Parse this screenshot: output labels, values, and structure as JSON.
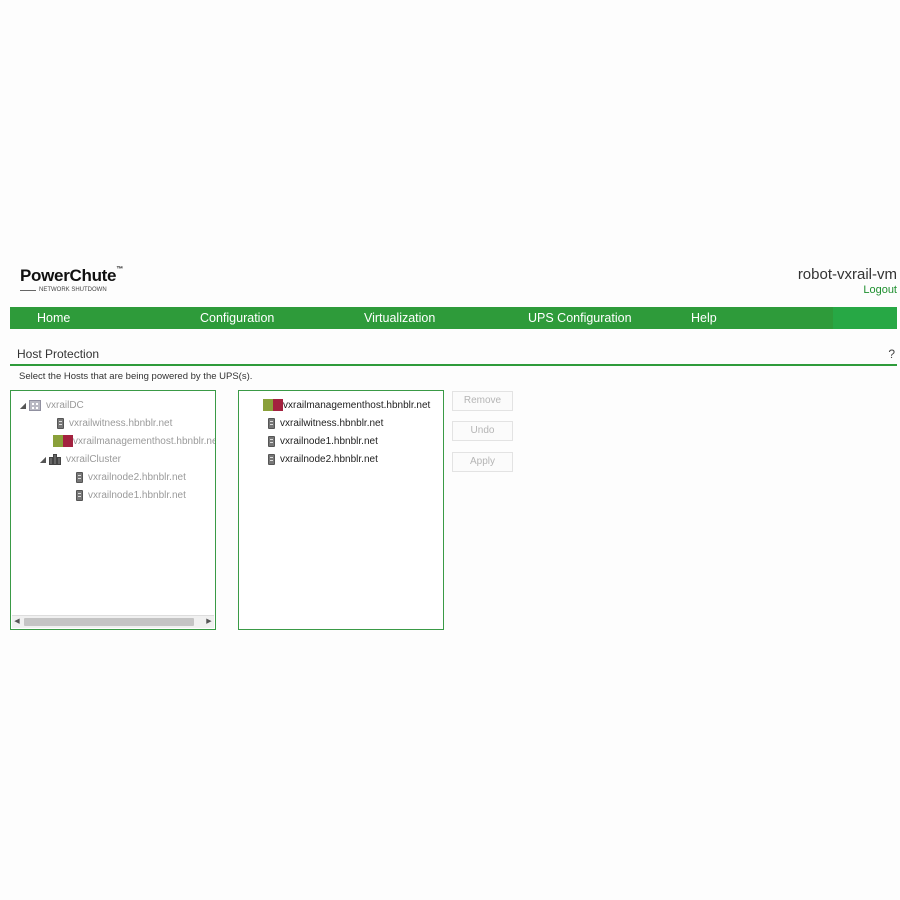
{
  "header": {
    "logo_title": "PowerChute",
    "logo_tm": "™",
    "logo_subtitle": "NETWORK SHUTDOWN",
    "hostname": "robot-vxrail-vm",
    "logout_label": "Logout"
  },
  "nav": {
    "items": [
      {
        "label": "Home"
      },
      {
        "label": "Configuration"
      },
      {
        "label": "Virtualization"
      },
      {
        "label": "UPS Configuration"
      },
      {
        "label": "Help"
      }
    ]
  },
  "section": {
    "title": "Host Protection",
    "help": "?",
    "instruction": "Select the Hosts that are being powered by the UPS(s)."
  },
  "available_tree": [
    {
      "label": "vxrailDC",
      "icon": "datacenter-icon",
      "expanded": true
    },
    {
      "label": "vxrailwitness.hbnblr.net",
      "icon": "server-icon"
    },
    {
      "label": "vxrailmanagementhost.hbnblr.ne",
      "icon": "vm-host-icon"
    },
    {
      "label": "vxrailCluster",
      "icon": "cluster-icon",
      "expanded": true
    },
    {
      "label": "vxrailnode2.hbnblr.net",
      "icon": "server-icon"
    },
    {
      "label": "vxrailnode1.hbnblr.net",
      "icon": "server-icon"
    }
  ],
  "selected_hosts": [
    {
      "label": "vxrailmanagementhost.hbnblr.net",
      "icon": "vm-host-icon"
    },
    {
      "label": "vxrailwitness.hbnblr.net",
      "icon": "server-icon"
    },
    {
      "label": "vxrailnode1.hbnblr.net",
      "icon": "server-icon"
    },
    {
      "label": "vxrailnode2.hbnblr.net",
      "icon": "server-icon"
    }
  ],
  "actions": {
    "remove_label": "Remove",
    "undo_label": "Undo",
    "apply_label": "Apply"
  },
  "colors": {
    "brand_green": "#2e9b3a",
    "link_green": "#1e8f2f"
  }
}
